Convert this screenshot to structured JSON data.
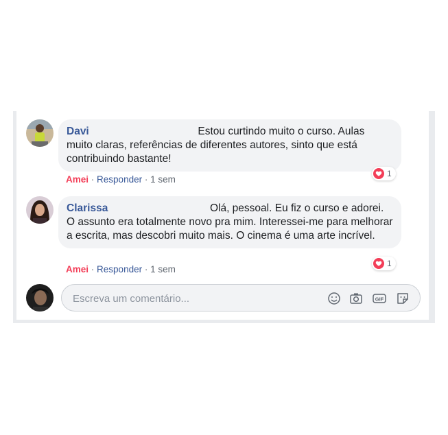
{
  "comments": [
    {
      "author": "Davi",
      "text": "Estou curtindo muito o curso. Aulas muito claras, referências de diferentes autores, sinto que está contribuindo bastante!",
      "like_label": "Amei",
      "reply_label": "Responder",
      "sep": "·",
      "time": "1 sem",
      "reaction_count": "1",
      "reaction_icon": "love-heart-icon"
    },
    {
      "author": "Clarissa",
      "text": "Olá, pessoal. Eu fiz o curso e adorei. O assunto era totalmente novo pra mim. Interessei-me para melhorar a escrita, mas descobri muito mais. O cinema é uma arte incrível.",
      "like_label": "Amei",
      "reply_label": "Responder",
      "sep": "·",
      "time": "1 sem",
      "reaction_count": "1",
      "reaction_icon": "love-heart-icon"
    }
  ],
  "composer": {
    "placeholder": "Escreva um comentário...",
    "icons": [
      "emoji-icon",
      "camera-icon",
      "gif-icon",
      "sticker-icon"
    ]
  },
  "colors": {
    "author": "#385898",
    "love": "#f33e58",
    "bubble": "#f2f3f5",
    "meta": "#606770"
  }
}
